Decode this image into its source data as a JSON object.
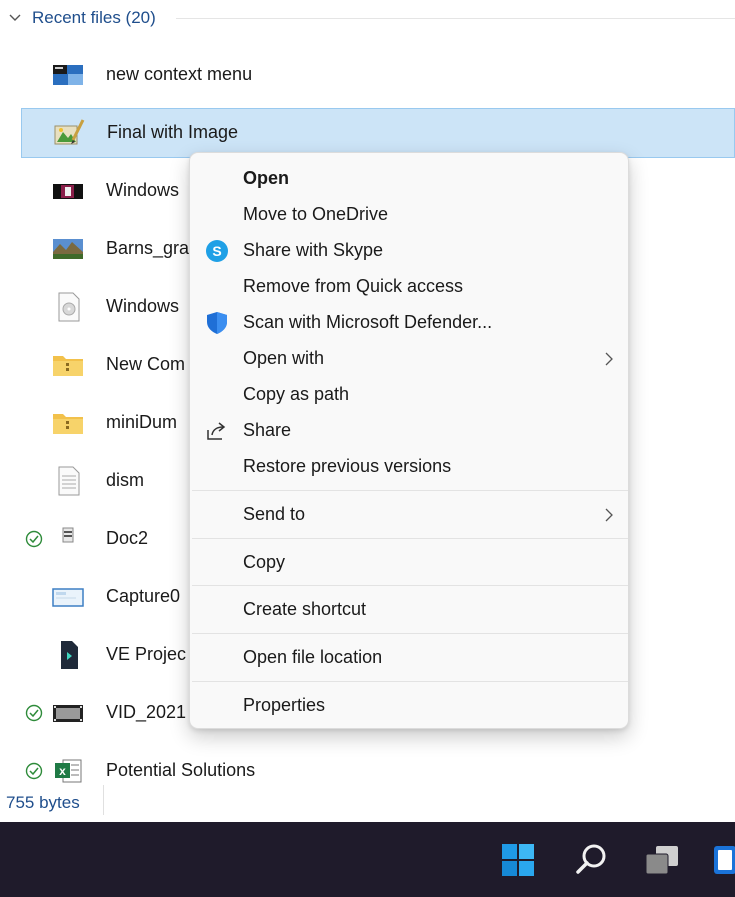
{
  "group": {
    "title": "Recent files (20)"
  },
  "files": [
    {
      "name": "new context menu",
      "icon": "image-thumbnail-icon",
      "status": ""
    },
    {
      "name": "Final with Image",
      "icon": "image-editor-file-icon",
      "status": "",
      "selected": true
    },
    {
      "name": "Windows",
      "icon": "video-thumbnail-icon",
      "status": ""
    },
    {
      "name": "Barns_gra",
      "icon": "landscape-image-icon",
      "status": ""
    },
    {
      "name": "Windows",
      "icon": "disc-image-file-icon",
      "status": ""
    },
    {
      "name": "New Com",
      "icon": "zip-folder-icon",
      "status": ""
    },
    {
      "name": "miniDum",
      "icon": "zip-folder-icon",
      "status": ""
    },
    {
      "name": "dism",
      "icon": "text-document-icon",
      "status": ""
    },
    {
      "name": "Doc2",
      "icon": "word-document-icon",
      "status": "synced"
    },
    {
      "name": "Capture0",
      "icon": "screenshot-image-icon",
      "status": ""
    },
    {
      "name": "VE Projec",
      "icon": "video-project-file-icon",
      "status": ""
    },
    {
      "name": "VID_2021",
      "icon": "video-file-icon",
      "status": "synced"
    },
    {
      "name": "Potential Solutions",
      "icon": "excel-file-icon",
      "status": "synced"
    }
  ],
  "status_bar": {
    "size": "755 bytes"
  },
  "context_menu": {
    "items": [
      {
        "label": "Open",
        "bold": true,
        "icon": "",
        "submenu": false
      },
      {
        "label": "Move to OneDrive",
        "icon": "",
        "submenu": false
      },
      {
        "label": "Share with Skype",
        "icon": "skype-icon",
        "submenu": false
      },
      {
        "label": "Remove from Quick access",
        "icon": "",
        "submenu": false
      },
      {
        "label": "Scan with Microsoft Defender...",
        "icon": "defender-shield-icon",
        "submenu": false
      },
      {
        "label": "Open with",
        "icon": "",
        "submenu": true
      },
      {
        "label": "Copy as path",
        "icon": "",
        "submenu": false
      },
      {
        "label": "Share",
        "icon": "share-icon",
        "submenu": false
      },
      {
        "label": "Restore previous versions",
        "icon": "",
        "submenu": false
      },
      {
        "label": "Send to",
        "icon": "",
        "submenu": true
      },
      {
        "label": "Copy",
        "icon": "",
        "submenu": false
      },
      {
        "label": "Create shortcut",
        "icon": "",
        "submenu": false
      },
      {
        "label": "Open file location",
        "icon": "",
        "submenu": false
      },
      {
        "label": "Properties",
        "icon": "",
        "submenu": false
      }
    ]
  },
  "taskbar": {
    "items": [
      "windows-start-icon",
      "search-icon",
      "task-view-icon",
      "widgets-icon"
    ]
  },
  "colors": {
    "accent": "#1f4e8c",
    "selection": "#cce4f7",
    "selection_border": "#99c9ef",
    "taskbar": "#1f1b2b",
    "sync_green": "#2e8b3a"
  }
}
